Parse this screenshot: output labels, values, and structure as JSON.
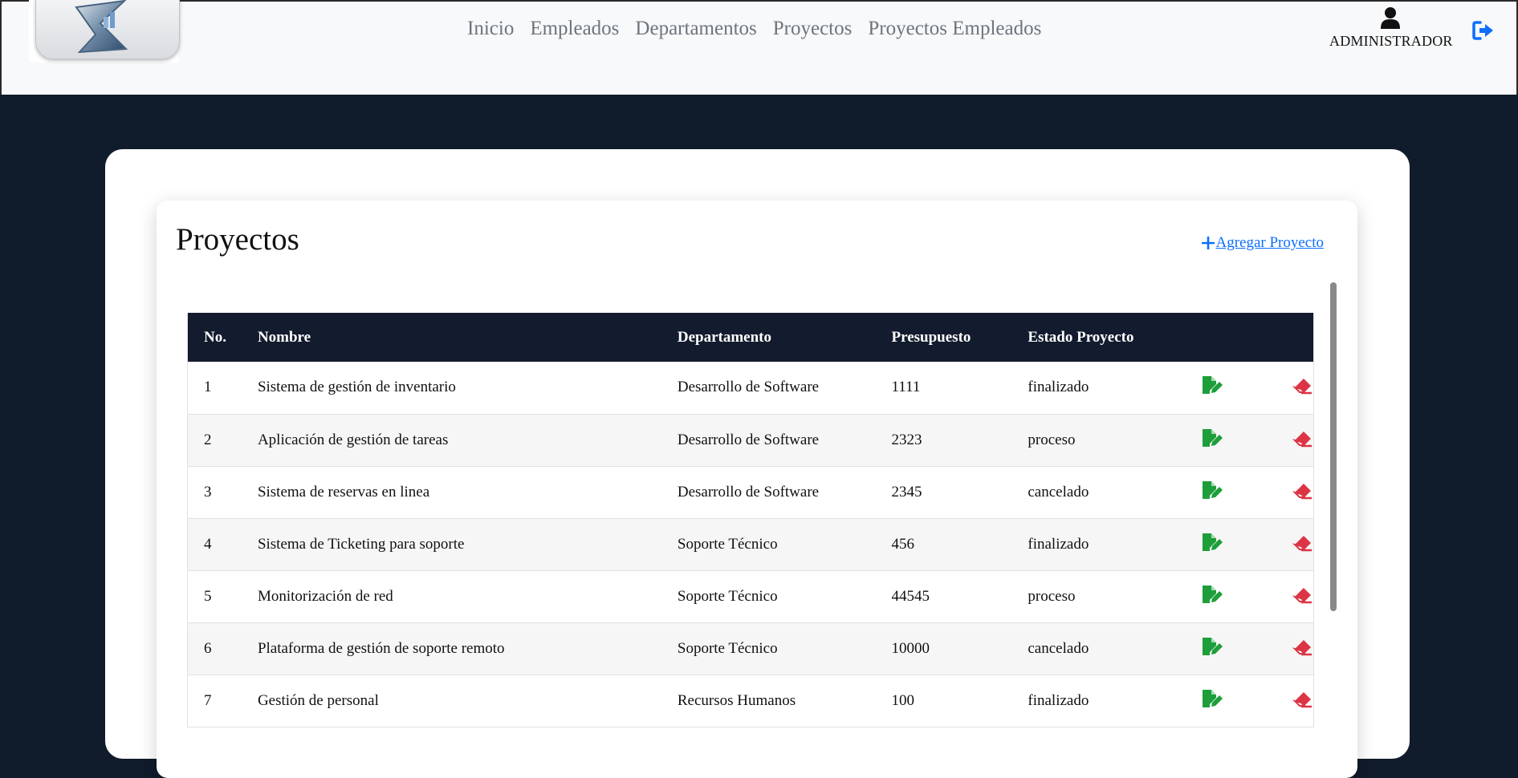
{
  "header": {
    "nav": [
      "Inicio",
      "Empleados",
      "Departamentos",
      "Proyectos",
      "Proyectos Empleados"
    ],
    "user_label": "ADMINISTRADOR",
    "icons": {
      "user": "user-icon",
      "logout": "logout-icon",
      "logo": "company-logo"
    }
  },
  "main": {
    "title": "Proyectos",
    "add_label": " Agregar Proyecto",
    "table": {
      "headers": [
        "No.",
        "Nombre",
        "Departamento",
        "Presupuesto",
        "Estado Proyecto"
      ],
      "rows": [
        [
          "1",
          "Sistema de gestión de inventario",
          "Desarrollo de Software",
          "1111",
          "finalizado"
        ],
        [
          "2",
          "Aplicación de gestión de tareas",
          "Desarrollo de Software",
          "2323",
          "proceso"
        ],
        [
          "3",
          "Sistema de reservas en linea",
          "Desarrollo de Software",
          "2345",
          "cancelado"
        ],
        [
          "4",
          "Sistema de Ticketing para soporte",
          "Soporte Técnico",
          "456",
          "finalizado"
        ],
        [
          "5",
          "Monitorización de red",
          "Soporte Técnico",
          "44545",
          "proceso"
        ],
        [
          "6",
          "Plataforma de gestión de soporte remoto",
          "Soporte Técnico",
          "10000",
          "cancelado"
        ],
        [
          "7",
          "Gestión de personal",
          "Recursos Humanos",
          "100",
          "finalizado"
        ]
      ],
      "row_actions": {
        "edit": "edit-file-icon",
        "delete": "eraser-icon"
      }
    }
  },
  "colors": {
    "page_bg": "#101b2b",
    "table_header_bg": "#131c2e",
    "edit": "#1e9e3a",
    "delete": "#dc3545",
    "link": "#0d6efd"
  }
}
